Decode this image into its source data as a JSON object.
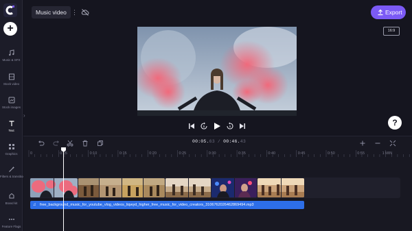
{
  "header": {
    "project_title": "Music video",
    "export_label": "Export",
    "aspect_ratio": "16:9",
    "menu_glyph": "⋮"
  },
  "sidebar": {
    "add_glyph": "+",
    "items": [
      {
        "label": "Music & SFX",
        "icon": "music-note-icon"
      },
      {
        "label": "Stock video",
        "icon": "film-icon"
      },
      {
        "label": "Stock images",
        "icon": "image-icon"
      },
      {
        "label": "Text",
        "icon": "text-icon",
        "active": true
      },
      {
        "label": "Graphics",
        "icon": "shapes-icon"
      },
      {
        "label": "Filters & transitions",
        "icon": "magic-wand-icon"
      },
      {
        "label": "Brand kit",
        "icon": "brand-icon"
      },
      {
        "label": "Feature Flags",
        "icon": "ellipsis-icon"
      }
    ],
    "collapse_glyph": "›"
  },
  "help_glyph": "?",
  "timeline": {
    "current_time": "00:05.",
    "current_frac": "63",
    "separator": " / ",
    "total_time": "00:46.",
    "total_frac": "43",
    "ruler_labels": [
      "0",
      "0:05",
      "0:10",
      "0:15",
      "0:20",
      "0:25",
      "0:30",
      "0:35",
      "0:40",
      "0:45",
      "0:50",
      "0:55",
      "1 MIN"
    ],
    "audio_filename": "free_background_music_for_youtube_vlog_videos_liqwyd_higher_free_music_for_video_creators_3106762026462869494.mp3",
    "audio_glyph": "♫",
    "playhead_fraction": 0.1216
  },
  "colors": {
    "accent": "#7b5af5",
    "audio": "#2d6ee8",
    "background": "#15151f"
  }
}
